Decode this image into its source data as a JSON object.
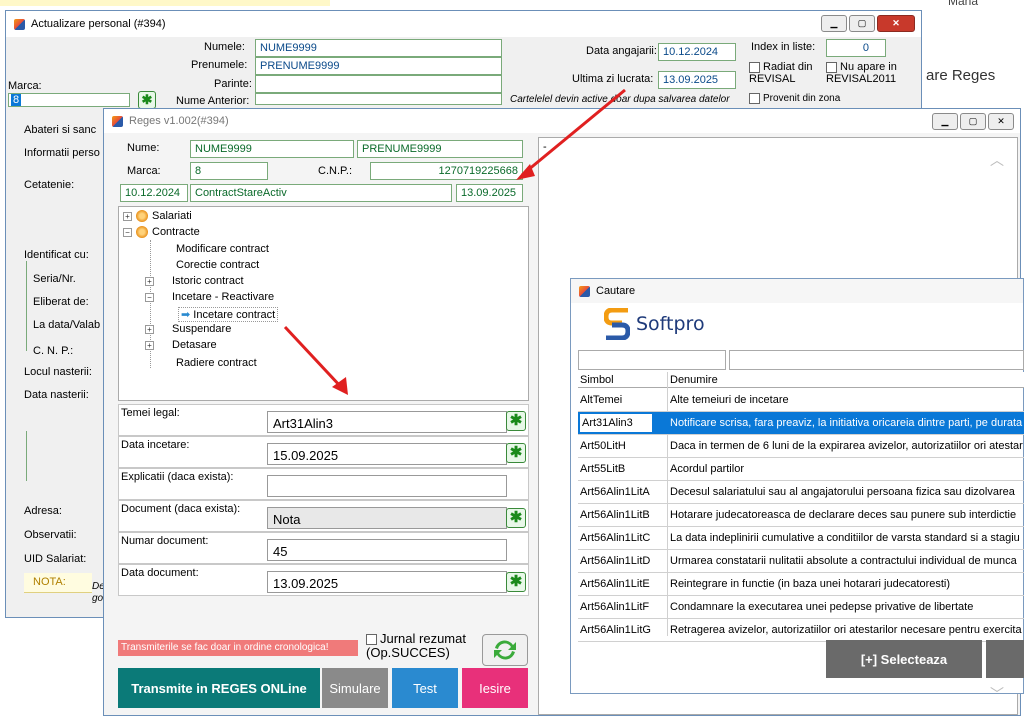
{
  "background_window": {
    "title": "Actualizare personal  (#394)",
    "labels": {
      "numele": "Numele:",
      "prenumele": "Prenumele:",
      "parinte": "Parinte:",
      "nume_anterior": "Nume Anterior:",
      "marca": "Marca:",
      "data_angajarii": "Data angajarii:",
      "ultima_zi": "Ultima zi lucrata:",
      "index_liste": "Index in liste:",
      "radiat": "Radiat din REVISAL",
      "nu_apare": "Nu apare in REVISAL2011",
      "provenit": "Provenit din zona",
      "note": "Cartelelel devin active doar dupa salvarea datelor"
    },
    "values": {
      "numele": "NUME9999",
      "prenumele": "PRENUME9999",
      "marca": "8",
      "data_angajarii": "10.12.2024",
      "ultima_zi": "13.09.2025",
      "index": "0"
    },
    "side_labels": [
      "Abateri si sanc",
      "Informatii perso",
      "Cetatenie:",
      "Identificat cu:",
      "Seria/Nr.",
      "Eliberat de:",
      "La data/Valab",
      "C. N. P.:",
      "Locul nasterii:",
      "Data nasterii:",
      "Adresa:",
      "Observatii:",
      "UID Salariat:",
      "NOTA:"
    ],
    "nota_text": "De",
    "nota_text2": "go"
  },
  "right_strip": {
    "text": "are Reges",
    "top_text": "Mana"
  },
  "reges_window": {
    "title": "Reges v1.002(#394)",
    "nume_label": "Nume:",
    "nume": "NUME9999",
    "prenume": "PRENUME9999",
    "marca_label": "Marca:",
    "marca": "8",
    "cnp_label": "C.N.P.:",
    "cnp": "1270719225668",
    "date1": "10.12.2024",
    "stare": "ContractStareActiv",
    "date2": "13.09.2025",
    "tree": [
      "Salariati",
      "Contracte",
      "Modificare contract",
      "Corectie contract",
      "Istoric contract",
      "Incetare - Reactivare",
      "Incetare contract",
      "Suspendare",
      "Detasare",
      "Radiere contract"
    ],
    "form": [
      {
        "label": "Temei legal:",
        "value": "Art31Alin3"
      },
      {
        "label": "Data incetare:",
        "value": "15.09.2025"
      },
      {
        "label": "Explicatii (daca exista):",
        "value": ""
      },
      {
        "label": "Document (daca exista):",
        "value": "Nota"
      },
      {
        "label": "Numar document:",
        "value": "45"
      },
      {
        "label": "Data document:",
        "value": "13.09.2025"
      }
    ],
    "warning": "Transmiterile se fac doar in ordine cronologica!",
    "jurnal": "Jurnal rezumat (Op.SUCCES)",
    "btn_transmite": "Transmite in REGES ONLine",
    "btn_simulare": "Simulare",
    "btn_test": "Test",
    "btn_iesire": "Iesire",
    "log_text": "-"
  },
  "cautare_window": {
    "title": "Cautare",
    "brand": "Softpro",
    "col_simbol": "Simbol",
    "col_denumire": "Denumire",
    "rows": [
      {
        "s": "AltTemei",
        "d": "Alte temeiuri de incetare"
      },
      {
        "s": "Art31Alin3",
        "d": "Notificare scrisa, fara preaviz, la initiativa oricareia dintre parti, pe durata"
      },
      {
        "s": "Art50LitH",
        "d": "Daca in termen de 6 luni de la expirarea avizelor, autorizatiilor ori atestar"
      },
      {
        "s": "Art55LitB",
        "d": "Acordul partilor"
      },
      {
        "s": "Art56Alin1LitA",
        "d": "Decesul salariatului sau al angajatorului persoana fizica sau dizolvarea"
      },
      {
        "s": "Art56Alin1LitB",
        "d": "Hotarare judecatoreasca de declarare deces sau punere sub interdictie"
      },
      {
        "s": "Art56Alin1LitC",
        "d": "La data indeplinirii cumulative a conditiilor de varsta standard si a stagiu"
      },
      {
        "s": "Art56Alin1LitD",
        "d": "Urmarea constatarii nulitatii absolute a contractului individual de munca"
      },
      {
        "s": "Art56Alin1LitE",
        "d": "Reintegrare in functie (in baza unei hotarari judecatoresti)"
      },
      {
        "s": "Art56Alin1LitF",
        "d": "Condamnare la executarea unei pedepse privative de libertate"
      },
      {
        "s": "Art56Alin1LitG",
        "d": "Retragerea avizelor, autorizatiilor ori atestarilor necesare pentru exercita"
      }
    ],
    "btn_select": "[+] Selecteaza"
  },
  "colors": {
    "teal": "#0b7a78",
    "gray": "#888888",
    "blue": "#2a8ad0",
    "pink": "#e8307a",
    "select_row": "#0a78d7",
    "warning": "#f07a7a"
  }
}
